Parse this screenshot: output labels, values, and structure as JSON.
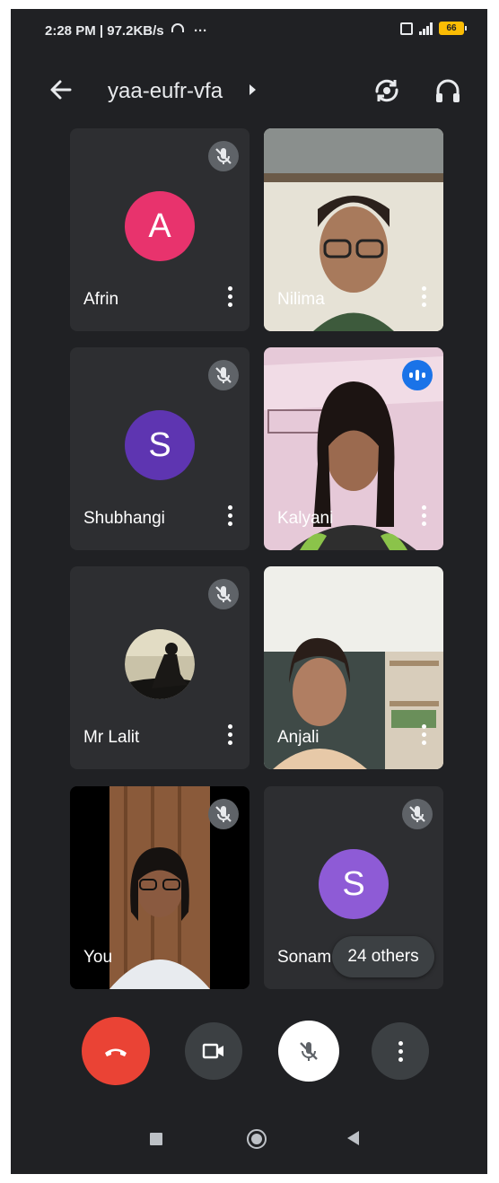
{
  "status_bar": {
    "time": "2:28 PM",
    "speed": "97.2KB/s",
    "more": "···",
    "battery": "66"
  },
  "header": {
    "meeting_code": "yaa-eufr-vfa",
    "back_icon": "arrow-left-icon",
    "switch_camera_icon": "switch-camera-icon",
    "audio_icon": "headphones-icon"
  },
  "participants": [
    {
      "name": "Afrin",
      "initial": "A",
      "avatar_color": "#e8336d",
      "muted": true,
      "type": "avatar"
    },
    {
      "name": "Nilima",
      "muted": false,
      "type": "video"
    },
    {
      "name": "Shubhangi",
      "initial": "S",
      "avatar_color": "#5e35b1",
      "muted": true,
      "type": "avatar"
    },
    {
      "name": "Kalyani",
      "muted": false,
      "speaking": true,
      "type": "video"
    },
    {
      "name": "Mr Lalit",
      "muted": true,
      "type": "photo"
    },
    {
      "name": "Anjali",
      "muted": false,
      "type": "video"
    },
    {
      "name": "You",
      "muted": true,
      "type": "video"
    },
    {
      "name": "Sonam",
      "initial": "S",
      "avatar_color": "#8e5bd6",
      "muted": true,
      "type": "avatar"
    }
  ],
  "others_chip": "24 others",
  "controls": {
    "end_call_icon": "end-call-icon",
    "camera_icon": "video-camera-icon",
    "mic_icon": "mic-off-icon",
    "more_icon": "more-vertical-icon",
    "end_call_color": "#ea4335"
  },
  "navbar": {
    "recents_icon": "square-icon",
    "home_icon": "circle-icon",
    "back_icon": "triangle-back-icon"
  }
}
